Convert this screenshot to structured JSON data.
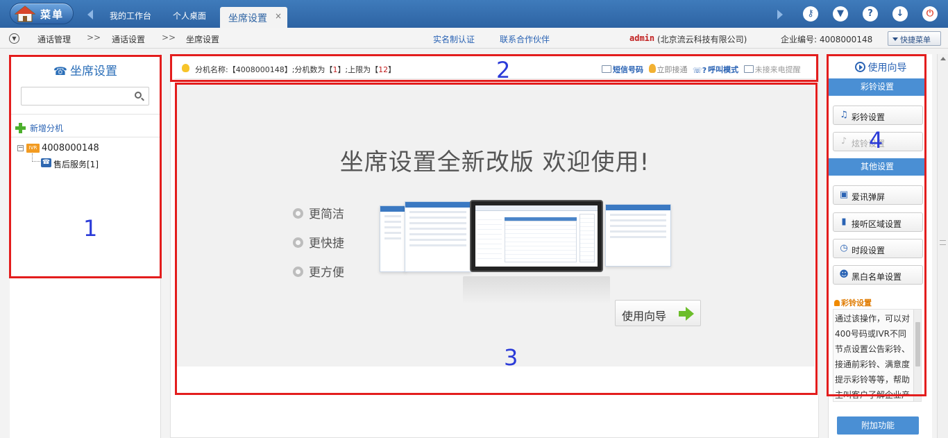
{
  "topbar": {
    "menu_label": "菜单",
    "tabs": [
      {
        "label": "我的工作台"
      },
      {
        "label": "个人桌面"
      }
    ],
    "active_tab": {
      "label": "坐席设置",
      "close": "×"
    },
    "icons": [
      "key-icon",
      "shirt-icon",
      "help-icon",
      "download-icon",
      "power-icon"
    ]
  },
  "navbar": {
    "breadcrumb": [
      "通话管理",
      "通话设置",
      "坐席设置"
    ],
    "separator": ">>",
    "links": [
      "实名制认证",
      "联系合作伙伴"
    ],
    "user": "admin",
    "company": "(北京流云科技有限公司)",
    "enterprise_id_label": "企业编号:",
    "enterprise_id": "4008000148",
    "quick_menu": "快捷菜单"
  },
  "left_panel": {
    "title": "坐席设置",
    "search_placeholder": "",
    "add_label": "新增分机",
    "tree": {
      "root_badge": "IVR",
      "root_label": "4008000148",
      "child_label": "售后服务[1]"
    }
  },
  "info_bar": {
    "prefix": "分机名称:【",
    "ext_name": "4008000148",
    "mid1": "】;分机数为【",
    "ext_count": "1",
    "mid2": "】;上限为【",
    "limit": "12",
    "suffix": "】",
    "actions": [
      "短信号码",
      "立即接通",
      "呼叫模式",
      "未接来电提醒"
    ]
  },
  "welcome": {
    "title": "坐席设置全新改版  欢迎使用!",
    "features": [
      "更简洁",
      "更快捷",
      "更方便"
    ],
    "guide_button": "使用向导"
  },
  "right_panel": {
    "head": "使用向导",
    "section1": "彩铃设置",
    "buttons1": [
      {
        "label": "彩铃设置",
        "icon": "music-note-icon"
      },
      {
        "label": "炫铃设置",
        "icon": "music-note-icon"
      }
    ],
    "section2": "其他设置",
    "buttons2": [
      {
        "label": "爱讯弹屏",
        "icon": "popup-icon"
      },
      {
        "label": "接听区域设置",
        "icon": "phone-area-icon"
      },
      {
        "label": "时段设置",
        "icon": "clock-icon"
      },
      {
        "label": "黑白名单设置",
        "icon": "users-icon"
      }
    ],
    "notice_title": "彩铃设置",
    "notice_text": "通过该操作，可以对400号码或IVR不同节点设置公告彩铃、接通前彩铃、满意度提示彩铃等等，帮助主叫客户了解企业产品信息。",
    "extra_button": "附加功能"
  },
  "annotations": [
    "1",
    "2",
    "3",
    "4"
  ],
  "colors": {
    "top_bar": "#2d63a3",
    "section_blue": "#4a8fd4",
    "annotation_red": "#e31d1d",
    "annotation_number": "#2b3bd8",
    "link_blue": "#2a63b4"
  }
}
